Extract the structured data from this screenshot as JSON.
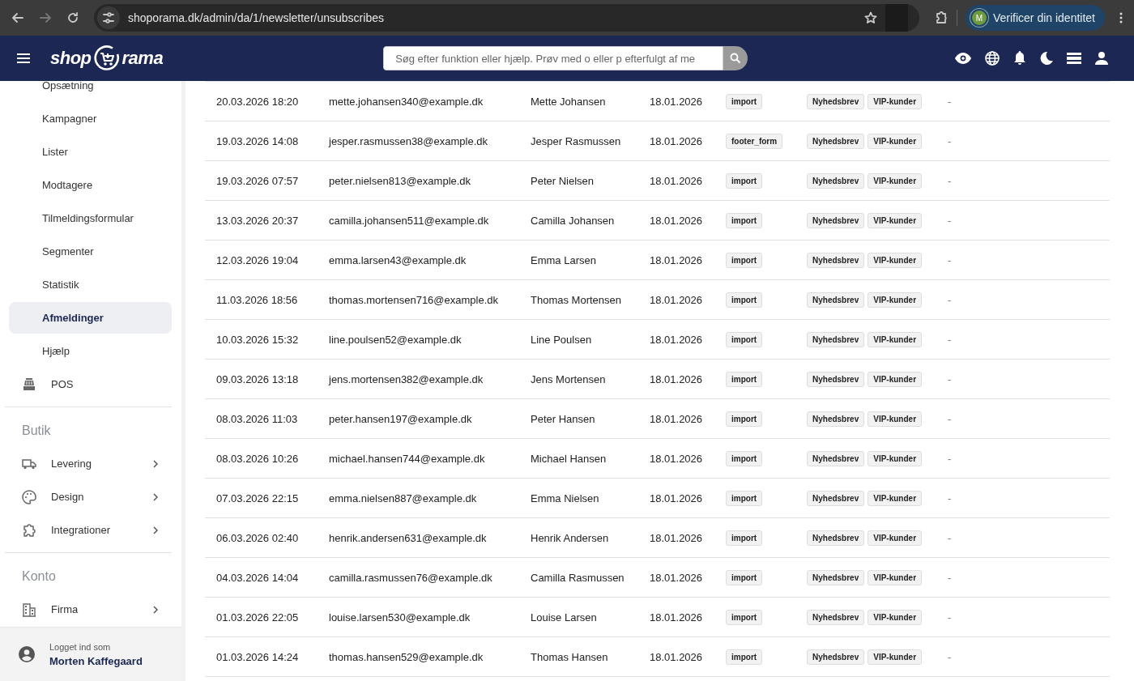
{
  "browser": {
    "url": "shoporama.dk/admin/da/1/newsletter/unsubscribes",
    "profile_initial": "M",
    "profile_label": "Verificer din identitet"
  },
  "header": {
    "logo_left": "shop",
    "logo_right": "rama",
    "search_placeholder": "Søg efter funktion eller hjælp. Prøv med o eller p efterfulgt af me"
  },
  "sidebar": {
    "groups": [
      {
        "items": [
          {
            "label": "Opsætning",
            "kind": "sub",
            "selected": false,
            "expandable": false
          },
          {
            "label": "Kampagner",
            "kind": "sub",
            "selected": false,
            "expandable": false
          },
          {
            "label": "Lister",
            "kind": "sub",
            "selected": false,
            "expandable": false
          },
          {
            "label": "Modtagere",
            "kind": "sub",
            "selected": false,
            "expandable": false
          },
          {
            "label": "Tilmeldingsformular",
            "kind": "sub",
            "selected": false,
            "expandable": false
          },
          {
            "label": "Segmenter",
            "kind": "sub",
            "selected": false,
            "expandable": false
          },
          {
            "label": "Statistik",
            "kind": "sub",
            "selected": false,
            "expandable": false
          },
          {
            "label": "Afmeldinger",
            "kind": "sub",
            "selected": true,
            "expandable": false
          },
          {
            "label": "Hjælp",
            "kind": "sub",
            "selected": false,
            "expandable": false
          },
          {
            "label": "POS",
            "kind": "main",
            "selected": false,
            "expandable": false
          }
        ]
      },
      {
        "heading": "Butik",
        "items": [
          {
            "label": "Levering",
            "kind": "main",
            "selected": false,
            "expandable": true
          },
          {
            "label": "Design",
            "kind": "main",
            "selected": false,
            "expandable": true
          },
          {
            "label": "Integrationer",
            "kind": "main",
            "selected": false,
            "expandable": true
          }
        ]
      },
      {
        "heading": "Konto",
        "items": [
          {
            "label": "Firma",
            "kind": "main",
            "selected": false,
            "expandable": true
          }
        ]
      }
    ],
    "footer": {
      "caption": "Logget ind som",
      "user": "Morten Kaffegaard"
    }
  },
  "table": {
    "rows": [
      {
        "date": "20.03.2026 18:20",
        "email": "mette.johansen340@example.dk",
        "name": "Mette Johansen",
        "signup": "18.01.2026",
        "source": "import",
        "lists": [
          "Nyhedsbrev",
          "VIP-kunder"
        ],
        "note": "-"
      },
      {
        "date": "19.03.2026 14:08",
        "email": "jesper.rasmussen38@example.dk",
        "name": "Jesper Rasmussen",
        "signup": "18.01.2026",
        "source": "footer_form",
        "lists": [
          "Nyhedsbrev",
          "VIP-kunder"
        ],
        "note": "-"
      },
      {
        "date": "19.03.2026 07:57",
        "email": "peter.nielsen813@example.dk",
        "name": "Peter Nielsen",
        "signup": "18.01.2026",
        "source": "import",
        "lists": [
          "Nyhedsbrev",
          "VIP-kunder"
        ],
        "note": "-"
      },
      {
        "date": "13.03.2026 20:37",
        "email": "camilla.johansen511@example.dk",
        "name": "Camilla Johansen",
        "signup": "18.01.2026",
        "source": "import",
        "lists": [
          "Nyhedsbrev",
          "VIP-kunder"
        ],
        "note": "-"
      },
      {
        "date": "12.03.2026 19:04",
        "email": "emma.larsen43@example.dk",
        "name": "Emma Larsen",
        "signup": "18.01.2026",
        "source": "import",
        "lists": [
          "Nyhedsbrev",
          "VIP-kunder"
        ],
        "note": "-"
      },
      {
        "date": "11.03.2026 18:56",
        "email": "thomas.mortensen716@example.dk",
        "name": "Thomas Mortensen",
        "signup": "18.01.2026",
        "source": "import",
        "lists": [
          "Nyhedsbrev",
          "VIP-kunder"
        ],
        "note": "-"
      },
      {
        "date": "10.03.2026 15:32",
        "email": "line.poulsen52@example.dk",
        "name": "Line Poulsen",
        "signup": "18.01.2026",
        "source": "import",
        "lists": [
          "Nyhedsbrev",
          "VIP-kunder"
        ],
        "note": "-"
      },
      {
        "date": "09.03.2026 13:18",
        "email": "jens.mortensen382@example.dk",
        "name": "Jens Mortensen",
        "signup": "18.01.2026",
        "source": "import",
        "lists": [
          "Nyhedsbrev",
          "VIP-kunder"
        ],
        "note": "-"
      },
      {
        "date": "08.03.2026 11:03",
        "email": "peter.hansen197@example.dk",
        "name": "Peter Hansen",
        "signup": "18.01.2026",
        "source": "import",
        "lists": [
          "Nyhedsbrev",
          "VIP-kunder"
        ],
        "note": "-"
      },
      {
        "date": "08.03.2026 10:26",
        "email": "michael.hansen744@example.dk",
        "name": "Michael Hansen",
        "signup": "18.01.2026",
        "source": "import",
        "lists": [
          "Nyhedsbrev",
          "VIP-kunder"
        ],
        "note": "-"
      },
      {
        "date": "07.03.2026 22:15",
        "email": "emma.nielsen887@example.dk",
        "name": "Emma Nielsen",
        "signup": "18.01.2026",
        "source": "import",
        "lists": [
          "Nyhedsbrev",
          "VIP-kunder"
        ],
        "note": "-"
      },
      {
        "date": "06.03.2026 02:40",
        "email": "henrik.andersen631@example.dk",
        "name": "Henrik Andersen",
        "signup": "18.01.2026",
        "source": "import",
        "lists": [
          "Nyhedsbrev",
          "VIP-kunder"
        ],
        "note": "-"
      },
      {
        "date": "04.03.2026 14:04",
        "email": "camilla.rasmussen76@example.dk",
        "name": "Camilla Rasmussen",
        "signup": "18.01.2026",
        "source": "import",
        "lists": [
          "Nyhedsbrev",
          "VIP-kunder"
        ],
        "note": "-"
      },
      {
        "date": "01.03.2026 22:05",
        "email": "louise.larsen530@example.dk",
        "name": "Louise Larsen",
        "signup": "18.01.2026",
        "source": "import",
        "lists": [
          "Nyhedsbrev",
          "VIP-kunder"
        ],
        "note": "-"
      },
      {
        "date": "01.03.2026 14:24",
        "email": "thomas.hansen529@example.dk",
        "name": "Thomas Hansen",
        "signup": "18.01.2026",
        "source": "import",
        "lists": [
          "Nyhedsbrev",
          "VIP-kunder"
        ],
        "note": "-"
      }
    ]
  }
}
